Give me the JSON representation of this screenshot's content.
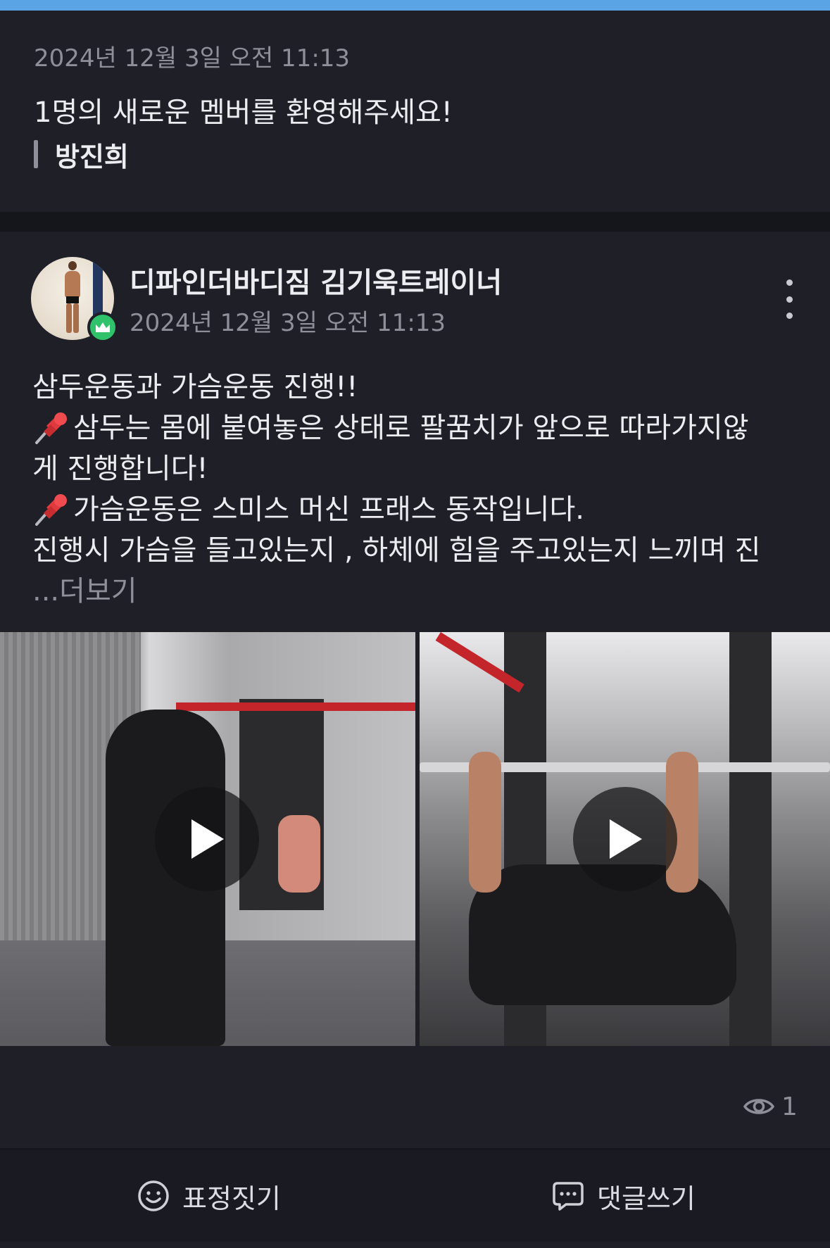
{
  "notice": {
    "timestamp": "2024년 12월 3일 오전 11:13",
    "message": "1명의 새로운 멤버를 환영해주세요!",
    "member_name": "방진희"
  },
  "post": {
    "author": "디파인더바디짐 김기욱트레이너",
    "timestamp": "2024년 12월 3일 오전 11:13",
    "body_lines": [
      "삼두운동과 가슴운동 진행!!",
      "삼두는 몸에 붙여놓은 상태로 팔꿈치가 앞으로 따라가지않",
      "게 진행합니다!",
      "가슴운동은 스미스 머신 프래스 동작입니다.",
      "진행시 가슴을 들고있는지 , 하체에 힘을 주고있는지 느끼며 진"
    ],
    "more_prefix": "...",
    "more_label": "더보기",
    "view_count": "1",
    "icons": {
      "pin": "pushpin-icon",
      "badge": "crown-icon",
      "more": "more-vertical-icon",
      "views": "eye-icon",
      "play": "play-icon",
      "react": "smiley-icon",
      "comment": "chat-bubble-icon"
    }
  },
  "actions": {
    "react_label": "표정짓기",
    "comment_label": "댓글쓰기"
  },
  "colors": {
    "background": "#1e1f27",
    "accent": "#5aa4e6",
    "badge": "#2fc26a",
    "muted_text": "#8e8f99"
  }
}
